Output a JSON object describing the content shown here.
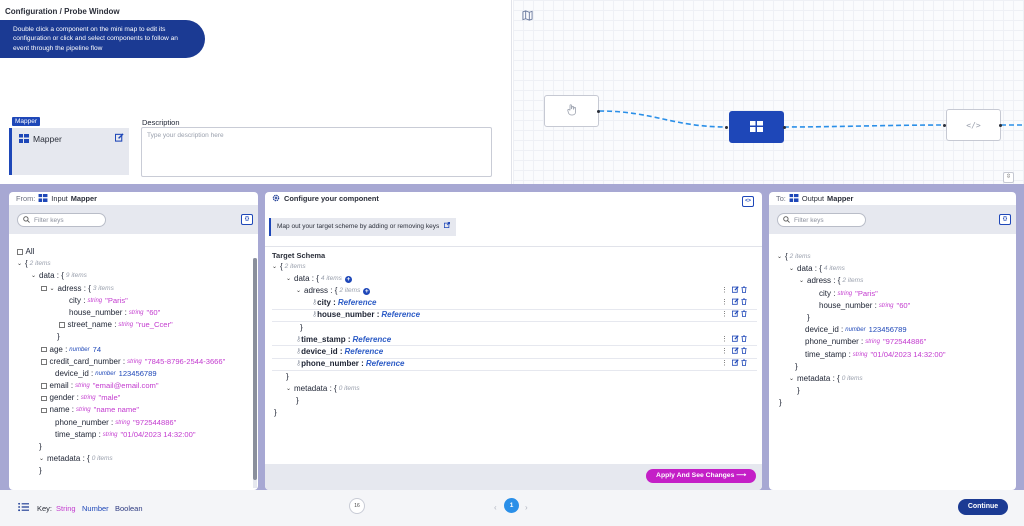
{
  "config": {
    "title": "Configuration / Probe Window",
    "info": "Double click a component on the mini map to edit its configuration or click and select components to follow an event through the pipeline flow",
    "mapper_tag": "Mapper",
    "mapper_name": "Mapper",
    "description_label": "Description",
    "description_placeholder": "Type your description here"
  },
  "panels": {
    "left": {
      "from": "From:",
      "label": "Input",
      "name": "Mapper",
      "filter_placeholder": "Filter keys",
      "code_label": "{}"
    },
    "middle": {
      "title": "Configure your component",
      "hint": "Map out your target scheme by adding or removing keys",
      "schema_title": "Target Schema",
      "apply_label": "Apply And See Changes",
      "code_label": "<>"
    },
    "right": {
      "to": "To:",
      "label": "Output",
      "name": "Mapper",
      "filter_placeholder": "Filter keys",
      "code_label": "{}"
    }
  },
  "input_tree": {
    "all_label": "All",
    "root_count": "2 items",
    "data_key": "data :",
    "data_count": "9 items",
    "adress_key": "adress :",
    "adress_count": "3 items",
    "city_key": "city :",
    "city_type": "string",
    "city_val": "\"Paris\"",
    "house_key": "house_number :",
    "house_type": "string",
    "house_val": "\"60\"",
    "street_key": "street_name :",
    "street_type": "string",
    "street_val": "\"rue_Ccer\"",
    "age_key": "age :",
    "age_type": "number",
    "age_val": "74",
    "cc_key": "credit_card_number :",
    "cc_type": "string",
    "cc_val": "\"7845-8796-2544-3666\"",
    "device_key": "device_id :",
    "device_type": "number",
    "device_val": "123456789",
    "email_key": "email :",
    "email_type": "string",
    "email_val": "\"email@email.com\"",
    "gender_key": "gender :",
    "gender_type": "string",
    "gender_val": "\"male\"",
    "name_key": "name :",
    "name_type": "string",
    "name_val": "\"name name\"",
    "phone_key": "phone_number :",
    "phone_type": "string",
    "phone_val": "\"972544886\"",
    "time_key": "time_stamp :",
    "time_type": "string",
    "time_val": "\"01/04/2023 14:32:00\"",
    "metadata_key": "metadata :",
    "metadata_count": "0 items"
  },
  "target_tree": {
    "root_count": "2 items",
    "data_key": "data :",
    "data_count": "4 items",
    "adress_key": "adress :",
    "adress_count": "2 items",
    "city_key": "city :",
    "house_key": "house_number :",
    "time_key": "time_stamp :",
    "device_key": "device_id :",
    "phone_key": "phone_number :",
    "ref": "Reference",
    "metadata_key": "metadata :",
    "metadata_count": "0 items"
  },
  "output_tree": {
    "root_count": "2 items",
    "data_key": "data :",
    "data_count": "4 items",
    "adress_key": "adress :",
    "adress_count": "2 items",
    "city_key": "city :",
    "city_type": "string",
    "city_val": "\"Paris\"",
    "house_key": "house_number :",
    "house_type": "string",
    "house_val": "\"60\"",
    "device_key": "device_id :",
    "device_type": "number",
    "device_val": "123456789",
    "phone_key": "phone_number :",
    "phone_type": "string",
    "phone_val": "\"972544886\"",
    "time_key": "time_stamp :",
    "time_type": "string",
    "time_val": "\"01/04/2023 14:32:00\"",
    "metadata_key": "metadata :",
    "metadata_count": "0 items"
  },
  "footer": {
    "key_label": "Key:",
    "key_string": "String",
    "key_number": "Number",
    "key_boolean": "Boolean",
    "zoom_label": "16",
    "page": "1",
    "continue_label": "Continue"
  },
  "colors": {
    "primary": "#1b3a93",
    "accent": "#1e47b8",
    "string": "#c33bcf",
    "number": "#1e47b8",
    "band": "#a7a8d3",
    "apply": "#c41fc7"
  },
  "icons": [
    "map-icon",
    "grid-icon",
    "edit-icon",
    "search-icon",
    "code-icon",
    "gear-icon",
    "plus-icon",
    "trash-icon",
    "link-icon",
    "list-icon",
    "hand-icon"
  ]
}
